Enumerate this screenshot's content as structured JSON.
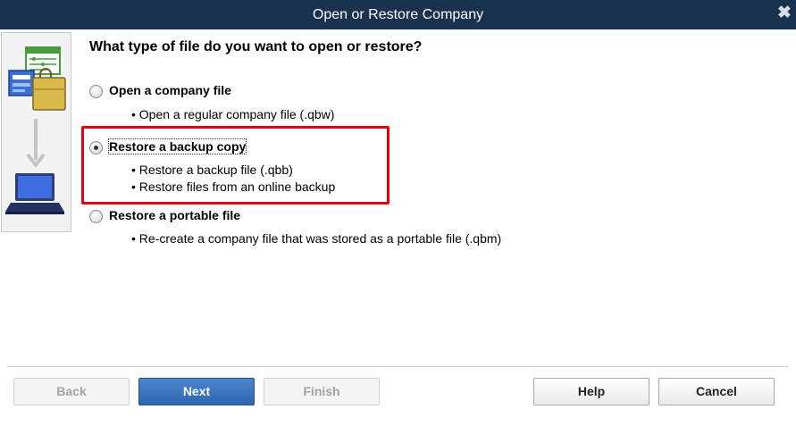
{
  "window": {
    "title": "Open or Restore Company",
    "close_glyph": "✖"
  },
  "question": "What type of file do you want to open or restore?",
  "options": [
    {
      "label": "Open a company file",
      "selected": false,
      "bullets": [
        "• Open a regular company file (.qbw)"
      ]
    },
    {
      "label": "Restore a backup copy",
      "selected": true,
      "bullets": [
        "• Restore a backup file (.qbb)",
        "• Restore files from an online backup"
      ]
    },
    {
      "label": "Restore a portable file",
      "selected": false,
      "bullets": [
        "• Re-create a company file that was stored as a portable file (.qbm)"
      ]
    }
  ],
  "buttons": {
    "back": "Back",
    "next": "Next",
    "finish": "Finish",
    "help": "Help",
    "cancel": "Cancel"
  },
  "colors": {
    "titlebar": "#19324f",
    "highlight": "#e8000f",
    "primary_button": "#3a73bf"
  },
  "icons": [
    "company-file-icon",
    "briefcase-icon",
    "down-arrow-icon",
    "laptop-icon"
  ]
}
